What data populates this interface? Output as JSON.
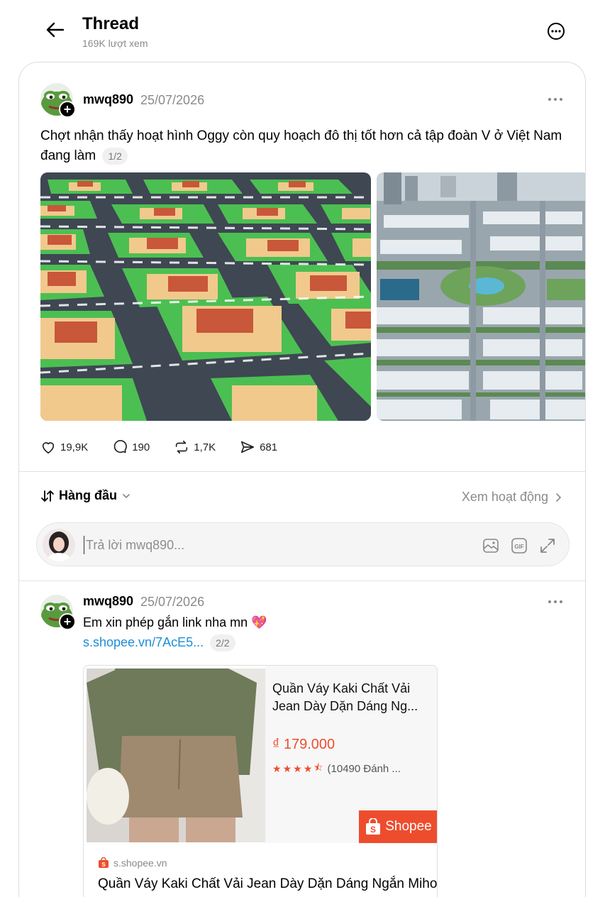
{
  "header": {
    "title": "Thread",
    "views": "169K lượt xem"
  },
  "post": {
    "username": "mwq890",
    "date": "25/07/2026",
    "text": "Chợt nhận thấy hoạt hình Oggy còn quy hoạch đô thị tốt hơn cả tập đoàn V ở Việt Nam đang làm",
    "counter": "1/2",
    "likes": "19,9K",
    "comments": "190",
    "reposts": "1,7K",
    "shares": "681"
  },
  "sort": {
    "label": "Hàng đầu",
    "activity": "Xem hoạt động"
  },
  "reply": {
    "placeholder": "Trả lời mwq890..."
  },
  "comment": {
    "username": "mwq890",
    "date": "25/07/2026",
    "text": "Em xin phép gắn link nha mn 💖",
    "link": "s.shopee.vn/7AcE5...",
    "counter": "2/2",
    "embed": {
      "title": "Quần Váy Kaki Chất Vải Jean Dày Dặn Dáng Ng...",
      "price": "₫ 179.000",
      "rating_count": "(10490 Đánh ...",
      "rating": 4.5,
      "badge": "Shopee",
      "domain": "s.shopee.vn",
      "name": "Quần Váy Kaki Chất Vải Jean Dày Dặn Dáng Ngắn Miho"
    }
  },
  "colors": {
    "accent": "#ee4d2d",
    "link": "#1d8dd8",
    "muted": "#8a8a8a"
  }
}
